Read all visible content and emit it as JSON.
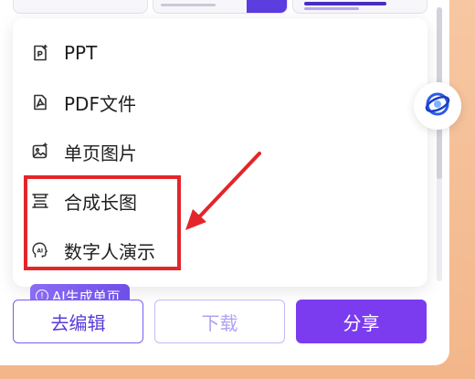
{
  "menu": {
    "items": [
      {
        "label": "PPT",
        "icon": "ppt-file-icon"
      },
      {
        "label": "PDF文件",
        "icon": "pdf-file-icon"
      },
      {
        "label": "单页图片",
        "icon": "image-icon"
      },
      {
        "label": "合成长图",
        "icon": "long-image-icon"
      },
      {
        "label": "数字人演示",
        "icon": "digital-human-icon"
      }
    ]
  },
  "tag": {
    "label": "AI生成单页",
    "icon": "info-circle-icon"
  },
  "actions": {
    "edit_label": "去编辑",
    "download_label": "下载",
    "share_label": "分享"
  },
  "colors": {
    "accent": "#7b3cf0",
    "highlight": "#e2262a",
    "background": "#f3b68a"
  }
}
